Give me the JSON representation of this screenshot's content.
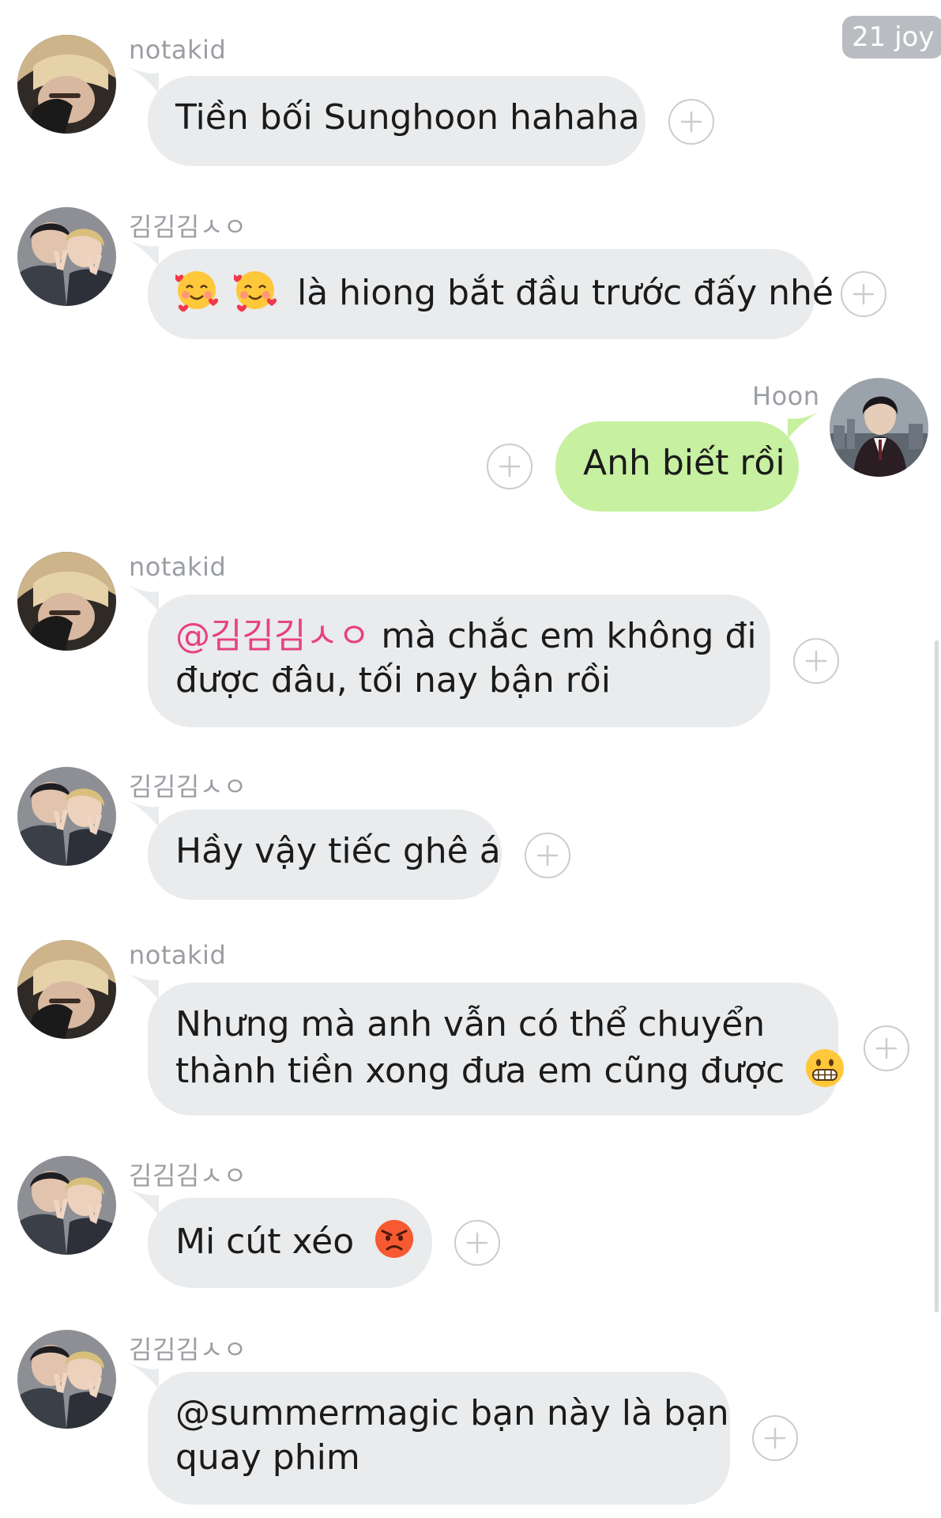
{
  "header": {
    "badge": "21 joy"
  },
  "messages": [
    {
      "sender": "notakid",
      "text": "Tiền bối Sunghoon hahaha",
      "direction": "incoming"
    },
    {
      "sender": "김김김ㅅㅇ",
      "emoji": [
        "smiling-face-with-hearts",
        "smiling-face-with-hearts"
      ],
      "text": "là hiong bắt đầu trước đấy nhé",
      "direction": "incoming"
    },
    {
      "sender": "Hoon",
      "text": "Anh biết rồi",
      "direction": "outgoing"
    },
    {
      "sender": "notakid",
      "mention": "@김김김ㅅㅇ",
      "text_line1": "mà chắc em không đi",
      "text_line2": "được đâu, tối nay bận rồi",
      "direction": "incoming"
    },
    {
      "sender": "김김김ㅅㅇ",
      "text": "Hầy vậy tiếc ghê á",
      "direction": "incoming"
    },
    {
      "sender": "notakid",
      "text_line1": "Nhưng mà anh vẫn có thể chuyển",
      "text_line2": "thành tiền xong đưa em cũng được",
      "emoji": [
        "grimacing-face"
      ],
      "direction": "incoming"
    },
    {
      "sender": "김김김ㅅㅇ",
      "text": "Mi cút xéo",
      "emoji": [
        "angry-face"
      ],
      "direction": "incoming"
    },
    {
      "sender": "김김김ㅅㅇ",
      "text_line1": "@summermagic bạn này là bạn",
      "text_line2": "quay phim",
      "direction": "incoming"
    }
  ],
  "colors": {
    "incoming_bubble": "#e9ebed",
    "outgoing_bubble": "#c7f0a0",
    "mention": "#e8417f",
    "sender_name": "#9a9ea3",
    "add_icon": "#c9ccd0"
  }
}
